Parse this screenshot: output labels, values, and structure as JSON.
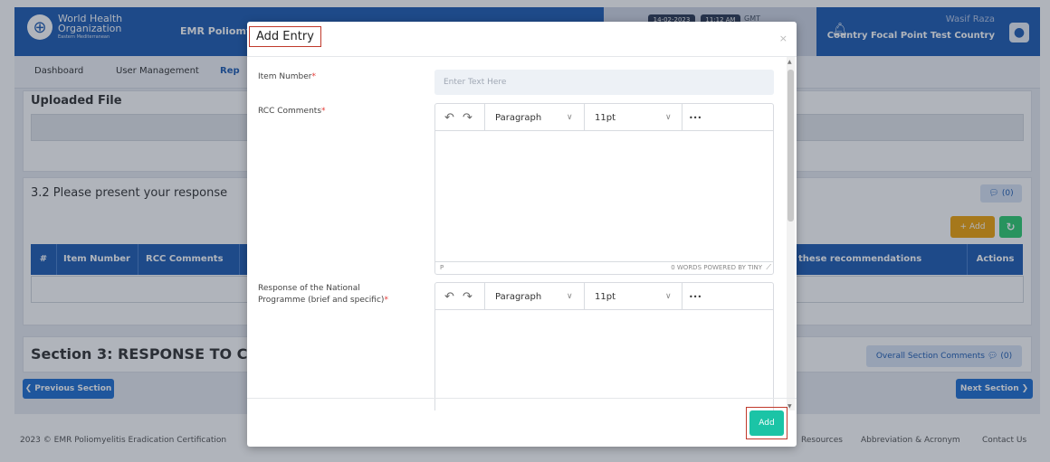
{
  "header": {
    "logo_line1": "World Health",
    "logo_line2": "Organization",
    "logo_line3": "Eastern Mediterranean",
    "app_title": "EMR Poliomyelit",
    "date": "14-02-2023",
    "time": "11:12 AM",
    "tz": "GMT",
    "user_name": "Wasif Raza",
    "user_role": "Country Focal Point Test Country"
  },
  "nav": {
    "items": [
      "Dashboard",
      "User Management",
      "Rep"
    ]
  },
  "page": {
    "uploaded_file_title": "Uploaded File",
    "q32_title": "3.2 Please present your response",
    "comments_count": "(0)",
    "add_label": "Add",
    "table_headers": [
      "#",
      "Item Number",
      "RCC Comments",
      "these recommendations",
      "Actions"
    ],
    "section_title": "Section 3: RESPONSE TO CO",
    "overall_comments_label": "Overall Section Comments",
    "overall_comments_count": "(0)",
    "prev_label": "Previous Section",
    "next_label": "Next Section"
  },
  "footer": {
    "copyright": "2023 ©  EMR Poliomyelitis Eradication Certification",
    "links": [
      "Resources",
      "Abbreviation & Acronym",
      "Contact Us"
    ]
  },
  "modal": {
    "title": "Add Entry",
    "close": "×",
    "fields": {
      "item_number_label": "Item Number",
      "item_number_placeholder": "Enter Text Here",
      "rcc_label": "RCC Comments",
      "response_label_line1": "Response of the National",
      "response_label_line2": "Programme (brief and specific)",
      "required_mark": "*"
    },
    "editor": {
      "format": "Paragraph",
      "font_size": "11pt",
      "more": "•••",
      "path": "P",
      "status": "0 WORDS  POWERED BY TINY"
    },
    "submit_label": "Add"
  },
  "colors": {
    "brand": "#1f5db3",
    "submit": "#1bc4a6",
    "highlight": "#c0392b",
    "add_orange": "#f0a30a",
    "refresh_green": "#2ecc71"
  }
}
